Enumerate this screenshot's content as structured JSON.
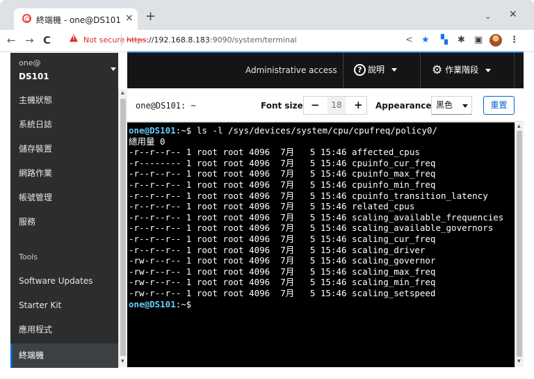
{
  "browser": {
    "tab_title": "終端機 - one@DS101",
    "tab_close": "×",
    "new_tab": "+",
    "tab_search": "⌄",
    "window_close": "✕",
    "back": "←",
    "forward": "→",
    "reload": "C",
    "not_secure": "Not secure",
    "url_scheme": "https",
    "url_host": "://192.168.8.183",
    "url_rest": ":9090/system/terminal"
  },
  "sidebar": {
    "host_user": "one@",
    "host_name": "DS101",
    "items": [
      {
        "label": "主機狀態"
      },
      {
        "label": "系統日誌"
      },
      {
        "label": "儲存裝置"
      },
      {
        "label": "網路作業"
      },
      {
        "label": "帳號管理"
      },
      {
        "label": "服務"
      }
    ],
    "tools_section": "Tools",
    "tools": [
      {
        "label": "Software Updates"
      },
      {
        "label": "Starter Kit"
      },
      {
        "label": "應用程式"
      },
      {
        "label": "終端機"
      }
    ]
  },
  "header": {
    "admin_access": "Administrative access",
    "help_label": "說明",
    "session_label": "作業階段"
  },
  "term_toolbar": {
    "title": "one@DS101: ~",
    "font_size_label": "Font size",
    "font_size_value": "18",
    "minus": "−",
    "plus": "+",
    "appearance_label": "Appearance",
    "appearance_value": "黑色",
    "reset_label": "重置"
  },
  "terminal": {
    "prompt_user": "one@DS101",
    "prompt_path": ":~$",
    "command": " ls -l /sys/devices/system/cpu/cpufreq/policy0/",
    "total": "總用量 0",
    "lines": [
      "-r--r--r-- 1 root root 4096  7月   5 15:46 affected_cpus",
      "-r-------- 1 root root 4096  7月   5 15:46 cpuinfo_cur_freq",
      "-r--r--r-- 1 root root 4096  7月   5 15:46 cpuinfo_max_freq",
      "-r--r--r-- 1 root root 4096  7月   5 15:46 cpuinfo_min_freq",
      "-r--r--r-- 1 root root 4096  7月   5 15:46 cpuinfo_transition_latency",
      "-r--r--r-- 1 root root 4096  7月   5 15:46 related_cpus",
      "-r--r--r-- 1 root root 4096  7月   5 15:46 scaling_available_frequencies",
      "-r--r--r-- 1 root root 4096  7月   5 15:46 scaling_available_governors",
      "-r--r--r-- 1 root root 4096  7月   5 15:46 scaling_cur_freq",
      "-r--r--r-- 1 root root 4096  7月   5 15:46 scaling_driver",
      "-rw-r--r-- 1 root root 4096  7月   5 15:46 scaling_governor",
      "-rw-r--r-- 1 root root 4096  7月   5 15:46 scaling_max_freq",
      "-rw-r--r-- 1 root root 4096  7月   5 15:46 scaling_min_freq",
      "-rw-r--r-- 1 root root 4096  7月   5 15:46 scaling_setspeed"
    ]
  }
}
